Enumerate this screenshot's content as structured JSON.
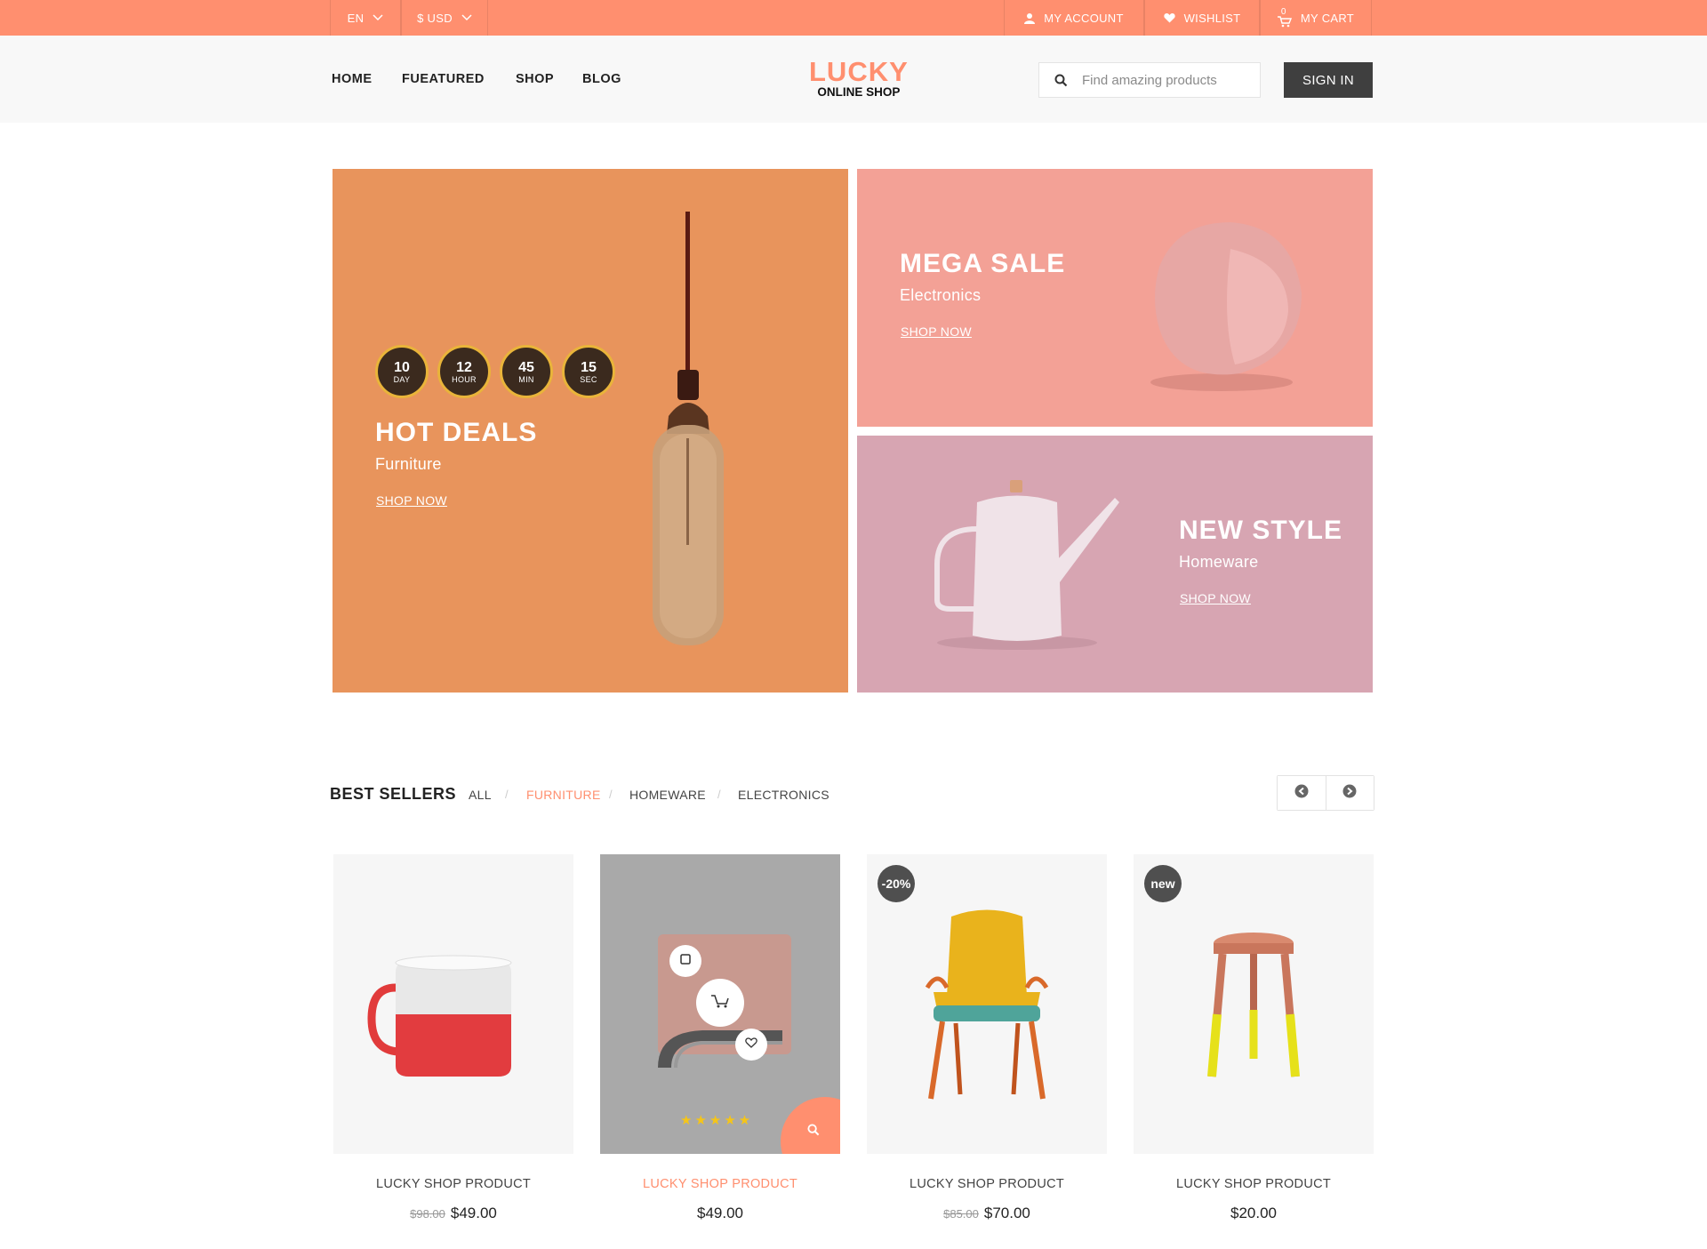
{
  "topbar": {
    "language": "EN",
    "currency": "$ USD",
    "account": "MY ACCOUNT",
    "wishlist": "WISHLIST",
    "cart_label": "MY CART",
    "cart_count": "0"
  },
  "nav": [
    "HOME",
    "FUEATURED",
    "SHOP",
    "BLOG"
  ],
  "logo": {
    "line1": "LUCKY",
    "line2": "ONLINE SHOP"
  },
  "search": {
    "placeholder": "Find amazing products"
  },
  "signin": "SIGN IN",
  "banners": {
    "hot": {
      "title": "HOT DEALS",
      "subtitle": "Furniture",
      "link": "SHOP NOW",
      "countdown": [
        {
          "value": "10",
          "unit": "DAY"
        },
        {
          "value": "12",
          "unit": "HOUR"
        },
        {
          "value": "45",
          "unit": "MIN"
        },
        {
          "value": "15",
          "unit": "SEC"
        }
      ]
    },
    "mega": {
      "title": "MEGA SALE",
      "subtitle": "Electronics",
      "link": "SHOP NOW"
    },
    "new": {
      "title": "NEW STYLE",
      "subtitle": "Homeware",
      "link": "SHOP NOW"
    }
  },
  "bestsellers": {
    "title": "BEST SELLERS",
    "filters": [
      "ALL",
      "FURNITURE",
      "HOMEWARE",
      "ELECTRONICS"
    ],
    "active_filter": "FURNITURE"
  },
  "products": [
    {
      "name": "LUCKY SHOP PRODUCT",
      "old_price": "$98.00",
      "price": "$49.00",
      "badge": ""
    },
    {
      "name": "LUCKY SHOP PRODUCT",
      "old_price": "",
      "price": "$49.00",
      "badge": "",
      "rating": "★★★★★"
    },
    {
      "name": "LUCKY SHOP PRODUCT",
      "old_price": "$85.00",
      "price": "$70.00",
      "badge": "-20%"
    },
    {
      "name": "LUCKY SHOP PRODUCT",
      "old_price": "",
      "price": "$20.00",
      "badge": "new"
    }
  ],
  "colors": {
    "accent": "#ff8f6f",
    "hot_banner": "#e8945c",
    "mega_banner": "#f3a196",
    "new_banner": "#d7a5b2",
    "dark": "#3f3f3f"
  }
}
